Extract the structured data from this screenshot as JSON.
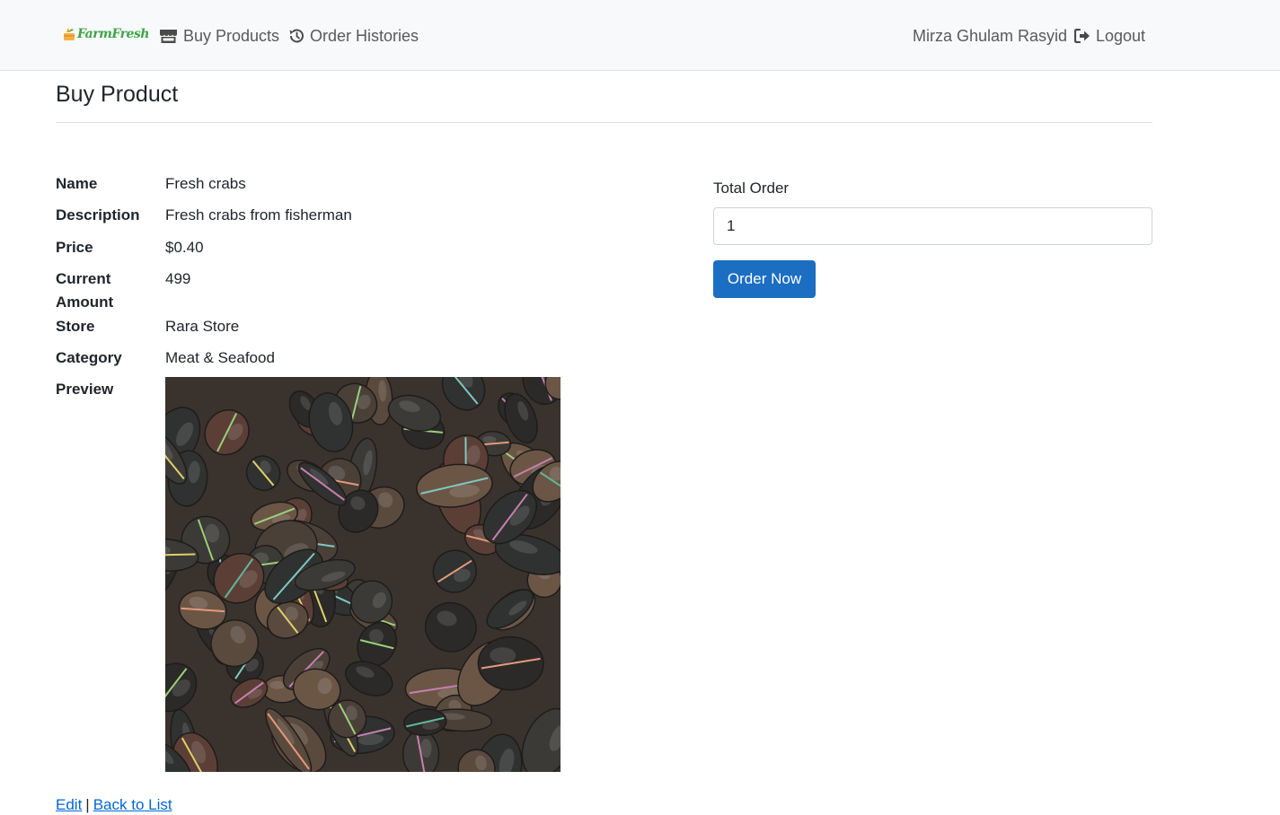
{
  "nav": {
    "brand": "FarmFresh",
    "links": [
      {
        "label": "Buy Products",
        "icon": "store-icon"
      },
      {
        "label": "Order Histories",
        "icon": "history-icon"
      }
    ],
    "user_name": "Mirza Ghulam Rasyid",
    "logout_label": "Logout",
    "logout_icon": "logout-icon"
  },
  "page": {
    "title": "Buy Product"
  },
  "details": {
    "name_label": "Name",
    "name_value": "Fresh crabs",
    "description_label": "Description",
    "description_value": "Fresh crabs from fisherman",
    "price_label": "Price",
    "price_value": "$0.40",
    "current_amount_label_line1": "Current",
    "current_amount_label_line2": "Amount",
    "current_amount_value": "499",
    "store_label": "Store",
    "store_value": "Rara Store",
    "category_label": "Category",
    "category_value": "Meat & Seafood",
    "preview_label": "Preview",
    "preview_image": "crabs-photo"
  },
  "order_form": {
    "total_order_label": "Total Order",
    "total_order_value": "1",
    "order_button_label": "Order Now",
    "button_color": "#1b6ec2"
  },
  "footer": {
    "edit_label": "Edit",
    "separator": "|",
    "back_label": "Back to List"
  },
  "colors": {
    "navbar_bg": "#f8f9fa",
    "link_blue": "#0366d6",
    "brand_green": "#3fa54a"
  }
}
